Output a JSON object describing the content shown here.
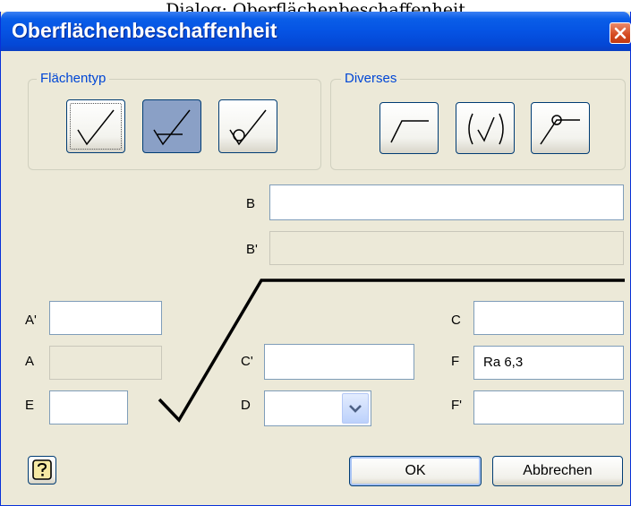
{
  "page_caption": "Dialog: Oberflächenbeschaffenheit",
  "window": {
    "title": "Oberflächenbeschaffenheit",
    "close_icon": "close-icon",
    "accent": "#0553e3"
  },
  "groups": {
    "surface_type": {
      "label": "Flächentyp",
      "buttons": [
        {
          "icon": "basic-surface-icon",
          "state": "focused"
        },
        {
          "icon": "material-removal-required-icon",
          "state": "pressed"
        },
        {
          "icon": "material-removal-prohibited-icon",
          "state": "normal"
        }
      ]
    },
    "misc": {
      "label": "Diverses",
      "buttons": [
        {
          "icon": "long-leg-icon"
        },
        {
          "icon": "parenthesized-symbol-icon"
        },
        {
          "icon": "all-around-icon"
        }
      ]
    }
  },
  "fields": {
    "B": {
      "label": "B",
      "value": ""
    },
    "B_prime": {
      "label": "B'",
      "value": ""
    },
    "A_prime": {
      "label": "A'",
      "value": ""
    },
    "A": {
      "label": "A",
      "value": ""
    },
    "E": {
      "label": "E",
      "value": ""
    },
    "C_prime": {
      "label": "C'",
      "value": ""
    },
    "D": {
      "label": "D",
      "value": ""
    },
    "C": {
      "label": "C",
      "value": ""
    },
    "F": {
      "label": "F",
      "value": "Ra 6,3"
    },
    "F_prime": {
      "label": "F'",
      "value": ""
    }
  },
  "buttons": {
    "help_icon": "help-icon",
    "ok": "OK",
    "cancel": "Abbrechen"
  }
}
